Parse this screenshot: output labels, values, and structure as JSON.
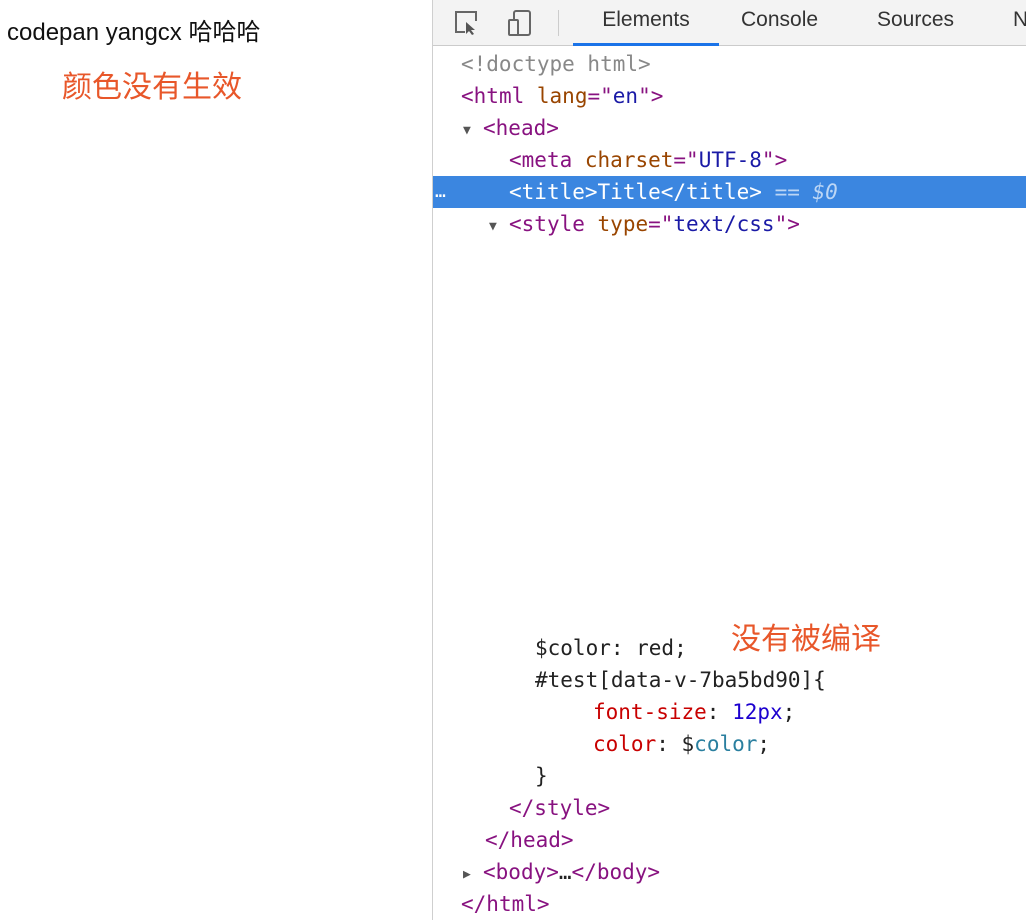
{
  "page": {
    "heading": "codepan yangcx 哈哈哈",
    "annotation_color": "颜色没有生效"
  },
  "devtools": {
    "tabs": [
      "Elements",
      "Console",
      "Sources",
      "N"
    ],
    "active_tab": "Elements",
    "icons": [
      "inspect-element-icon",
      "device-toolbar-icon"
    ],
    "selection_color": "#3b86e0",
    "accent_color": "#1a73e8",
    "annotation_color": "#e8572a",
    "dom": {
      "doctype": "<!doctype html>",
      "html_tag": "html",
      "html_attr_name": "lang",
      "html_attr_value": "en",
      "head_tag": "head",
      "meta_tag": "meta",
      "meta_attr_name": "charset",
      "meta_attr_value": "UTF-8",
      "title_tag": "title",
      "title_text": "Title",
      "selected_marker": "== $0",
      "style_tag": "style",
      "style_attr_name": "type",
      "style_attr_value": "text/css",
      "css_var_decl": "$color: red;",
      "css_selector": "#test[data-v-7ba5bd90]{",
      "css_prop_fontsize": "font-size",
      "css_val_fontsize": "12px",
      "css_prop_color": "color",
      "css_val_color_prefix": "$",
      "css_val_color_name": "color",
      "css_close_brace": "}",
      "body_tag": "body",
      "body_ellipsis": "…",
      "annotation_compile": "没有被编译"
    }
  }
}
